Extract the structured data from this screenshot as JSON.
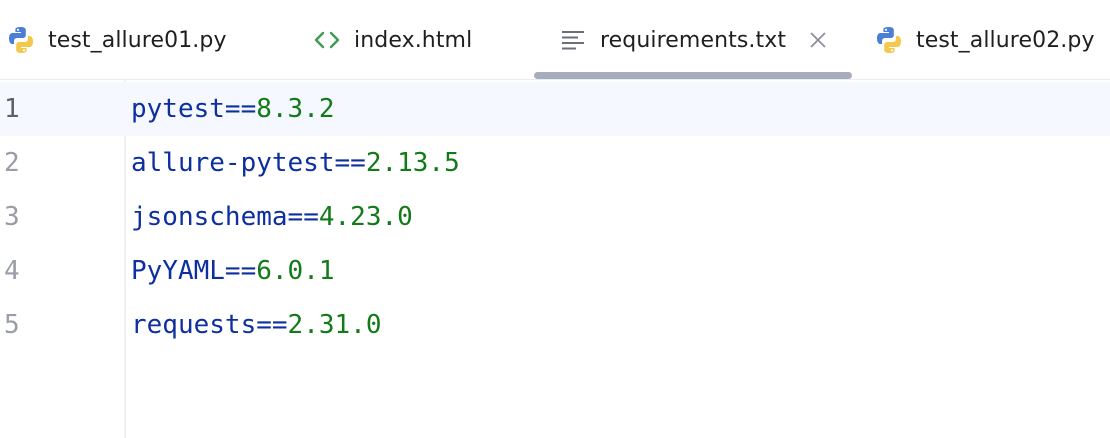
{
  "tabs": [
    {
      "label": "test_allure01.py",
      "icon": "python-file-icon",
      "active": false
    },
    {
      "label": "index.html",
      "icon": "html-file-icon",
      "active": false
    },
    {
      "label": "requirements.txt",
      "icon": "text-file-icon",
      "active": true
    },
    {
      "label": "test_allure02.py",
      "icon": "python-file-icon",
      "active": false
    }
  ],
  "close_icon": "close-icon",
  "editor": {
    "current_line": 1,
    "lines": [
      {
        "number": "1",
        "package": "pytest",
        "operator": "==",
        "version": "8.3.2"
      },
      {
        "number": "2",
        "package": "allure-pytest",
        "operator": "==",
        "version": "2.13.5"
      },
      {
        "number": "3",
        "package": "jsonschema",
        "operator": "==",
        "version": "4.23.0"
      },
      {
        "number": "4",
        "package": "PyYAML",
        "operator": "==",
        "version": "6.0.1"
      },
      {
        "number": "5",
        "package": "requests",
        "operator": "==",
        "version": "2.31.0"
      }
    ]
  },
  "colors": {
    "package": "#0e2fa0",
    "version": "#127a19",
    "current_line_bg": "#f5f8fe",
    "tab_underline": "#a8adbd"
  }
}
